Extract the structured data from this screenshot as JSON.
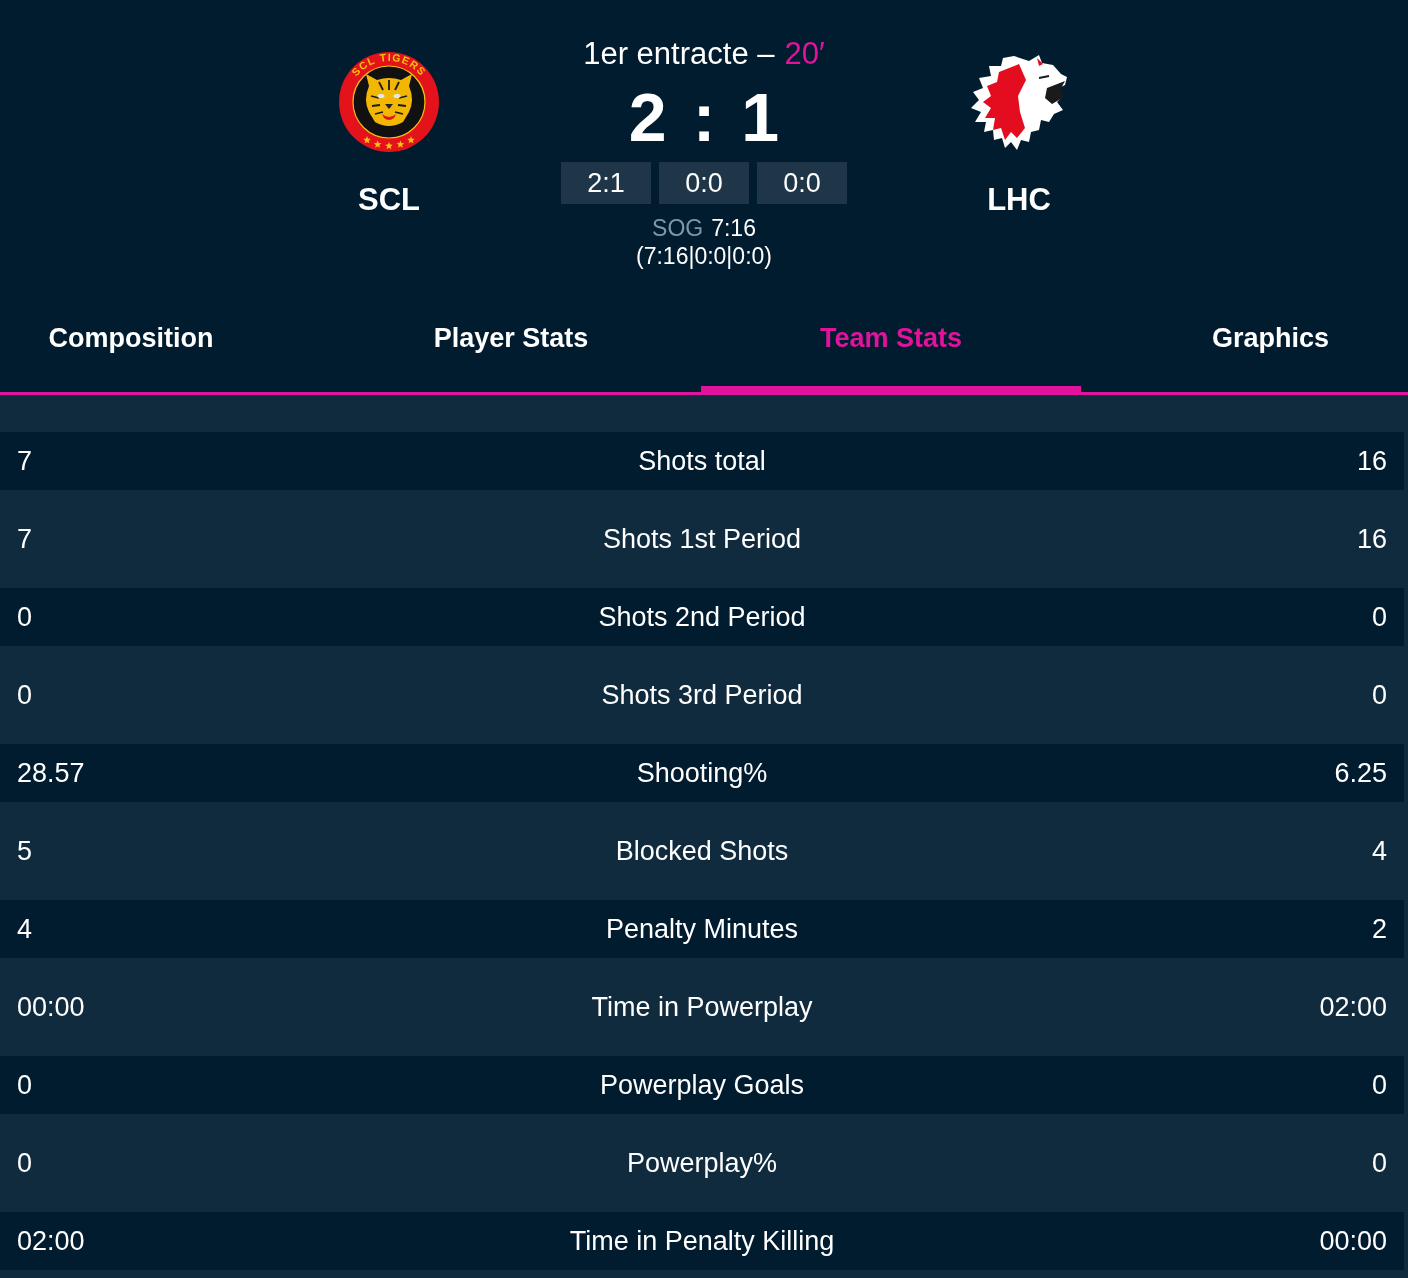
{
  "header": {
    "home": {
      "abbr": "SCL",
      "logo_text": "SCL TIGERS"
    },
    "status": "1er entracte –",
    "minute": "20′",
    "score": {
      "home": "2",
      "separator": ":",
      "away": "1"
    },
    "periods": [
      "2:1",
      "0:0",
      "0:0"
    ],
    "shots_on_goal": {
      "label": "SOG",
      "value": "7:16",
      "by_period": "(7:16|0:0|0:0)"
    },
    "away": {
      "abbr": "LHC"
    }
  },
  "tabs": [
    {
      "label": "Composition",
      "selected": false
    },
    {
      "label": "Player Stats",
      "selected": false
    },
    {
      "label": "Team Stats",
      "selected": true
    },
    {
      "label": "Graphics",
      "selected": false
    }
  ],
  "stats": {
    "rows": [
      {
        "home": "7",
        "label": "Shots total",
        "away": "16"
      },
      {
        "home": "7",
        "label": "Shots 1st Period",
        "away": "16"
      },
      {
        "home": "0",
        "label": "Shots 2nd Period",
        "away": "0"
      },
      {
        "home": "0",
        "label": "Shots 3rd Period",
        "away": "0"
      },
      {
        "home": "28.57",
        "label": "Shooting%",
        "away": "6.25"
      },
      {
        "home": "5",
        "label": "Blocked Shots",
        "away": "4"
      },
      {
        "home": "4",
        "label": "Penalty Minutes",
        "away": "2"
      },
      {
        "home": "00:00",
        "label": "Time in Powerplay",
        "away": "02:00"
      },
      {
        "home": "0",
        "label": "Powerplay Goals",
        "away": "0"
      },
      {
        "home": "0",
        "label": "Powerplay%",
        "away": "0"
      },
      {
        "home": "02:00",
        "label": "Time in Penalty Killing",
        "away": "00:00"
      }
    ]
  }
}
